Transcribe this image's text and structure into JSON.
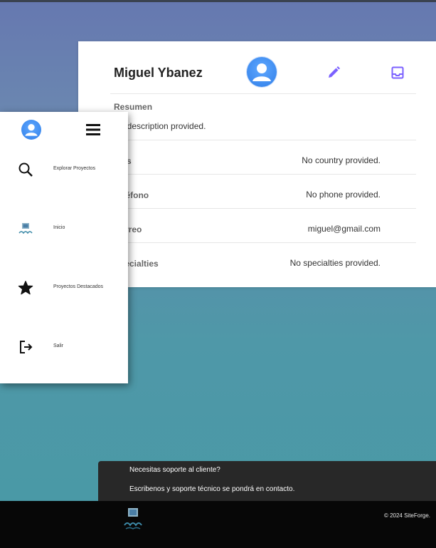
{
  "profile": {
    "name": "Miguel Ybanez",
    "resumen_label": "Resumen",
    "description": "No description provided.",
    "rows": [
      {
        "label": "País",
        "value": "No country provided."
      },
      {
        "label": "Teléfono",
        "value": "No phone provided."
      },
      {
        "label": "Correo",
        "value": "miguel@gmail.com"
      },
      {
        "label": "Specialties",
        "value": "No specialties provided."
      }
    ]
  },
  "sidebar": {
    "items": [
      {
        "label": "Explorar Proyectos",
        "icon": "search-icon"
      },
      {
        "label": "Inicio",
        "icon": "frog-logo-icon"
      },
      {
        "label": "Proyectos Destacados",
        "icon": "star-icon"
      },
      {
        "label": "Salir",
        "icon": "logout-icon"
      }
    ]
  },
  "support": {
    "question": "Necesitas soporte al cliente?",
    "answer": "Escribenos y soporte técnico se pondrá en contacto."
  },
  "footer": {
    "copyright": "© 2024 SiteForge."
  },
  "colors": {
    "accent": "#7b61ff",
    "avatar": "#2f7ee8",
    "support_bg": "#282828",
    "footer_bg": "#070707"
  }
}
